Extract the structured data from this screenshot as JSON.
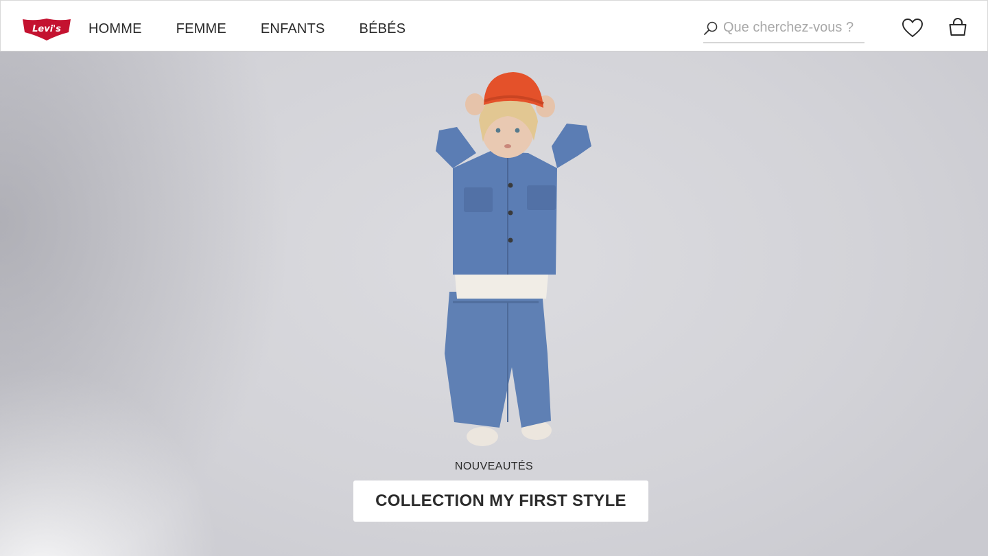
{
  "brand": {
    "logo_text": "Levi's",
    "color": "#c41230"
  },
  "nav": {
    "items": [
      "HOMME",
      "FEMME",
      "ENFANTS",
      "BÉBÉS"
    ]
  },
  "search": {
    "placeholder": "Que cherchez-vous ?",
    "icon": "search-icon"
  },
  "header_icons": {
    "wishlist": "heart-icon",
    "cart": "shopping-bag-icon"
  },
  "hero": {
    "eyebrow": "NOUVEAUTÉS",
    "cta_label": "COLLECTION MY FIRST STYLE"
  }
}
